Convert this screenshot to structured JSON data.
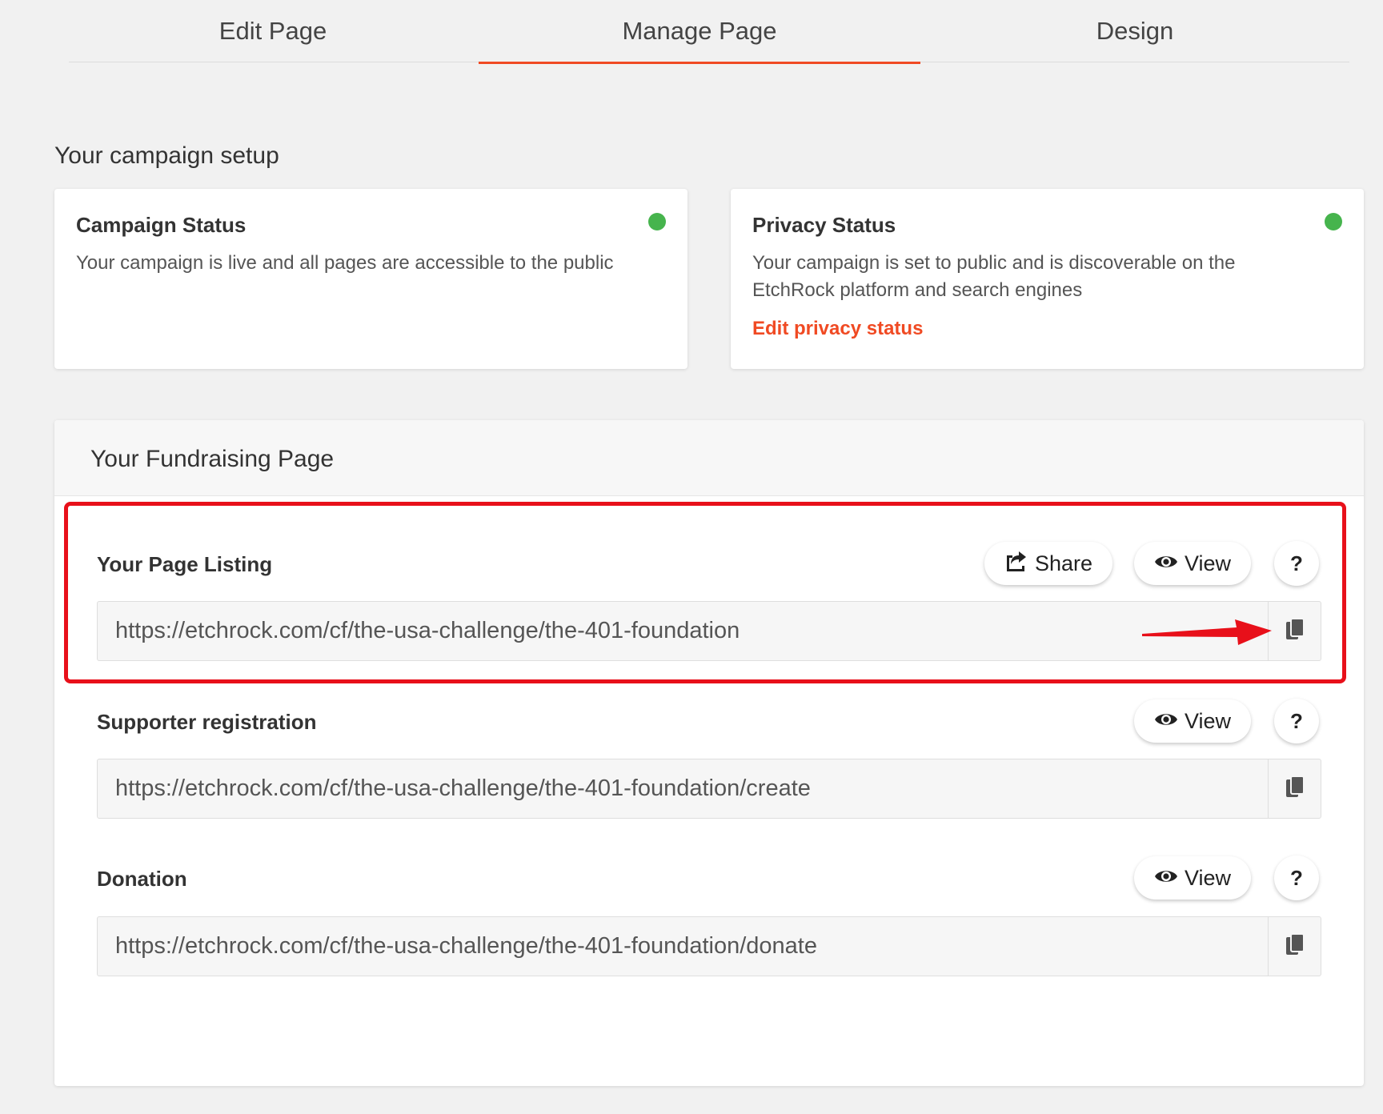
{
  "tabs": [
    {
      "label": "Edit Page",
      "active": false
    },
    {
      "label": "Manage Page",
      "active": true
    },
    {
      "label": "Design",
      "active": false
    }
  ],
  "setup": {
    "title": "Your campaign setup",
    "campaign_status": {
      "title": "Campaign Status",
      "description": "Your campaign is live and all pages are accessible to the public",
      "status_color": "#46b44d"
    },
    "privacy_status": {
      "title": "Privacy Status",
      "description": "Your campaign is set to public and is discoverable on the EtchRock platform and search engines",
      "link": "Edit privacy status",
      "status_color": "#46b44d"
    }
  },
  "fundraising": {
    "title": "Your Fundraising Page",
    "rows": [
      {
        "label": "Your Page Listing",
        "share_label": "Share",
        "view_label": "View",
        "help_label": "?",
        "url": "https://etchrock.com/cf/the-usa-challenge/the-401-foundation"
      },
      {
        "label": "Supporter registration",
        "view_label": "View",
        "help_label": "?",
        "url": "https://etchrock.com/cf/the-usa-challenge/the-401-foundation/create"
      },
      {
        "label": "Donation",
        "view_label": "View",
        "help_label": "?",
        "url": "https://etchrock.com/cf/the-usa-challenge/the-401-foundation/donate"
      }
    ]
  },
  "colors": {
    "accent": "#f04a23",
    "annotation": "#e8101a",
    "status_green": "#46b44d"
  },
  "icons": {
    "share": "share-icon",
    "view": "eye-icon",
    "copy": "copy-icon"
  }
}
